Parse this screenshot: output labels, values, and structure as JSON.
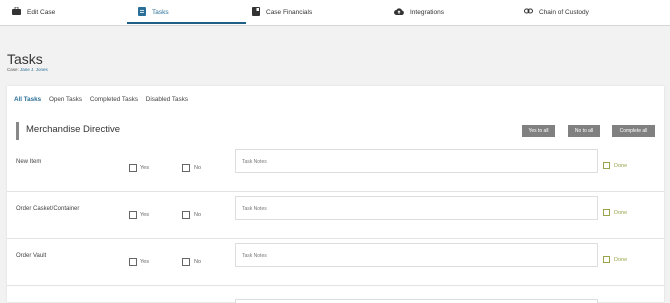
{
  "nav": {
    "tabs": [
      {
        "label": "Edit Case",
        "icon": "briefcase-icon"
      },
      {
        "label": "Tasks",
        "icon": "clipboard-icon"
      },
      {
        "label": "Case Financials",
        "icon": "ledger-icon"
      },
      {
        "label": "Integrations",
        "icon": "cloud-icon"
      },
      {
        "label": "Chain of Custody",
        "icon": "link-icon"
      }
    ],
    "active_tab": "Tasks"
  },
  "page": {
    "title": "Tasks",
    "case_prefix": "Case:",
    "case_name": "Jane J. Jones"
  },
  "subtabs": [
    {
      "label": "All Tasks",
      "active": true
    },
    {
      "label": "Open Tasks",
      "active": false
    },
    {
      "label": "Completed Tasks",
      "active": false
    },
    {
      "label": "Disabled Tasks",
      "active": false
    }
  ],
  "section": {
    "title": "Merchandise Directive",
    "buttons": {
      "yes_all": "Yes to all",
      "no_all": "No to all",
      "complete_all": "Complete all"
    }
  },
  "tasks": [
    {
      "name": "New Item",
      "yes_label": "Yes",
      "no_label": "No",
      "notes_placeholder": "Task Notes",
      "done_label": "Done"
    },
    {
      "name": "Order Casket/Container",
      "yes_label": "Yes",
      "no_label": "No",
      "notes_placeholder": "Task Notes",
      "done_label": "Done"
    },
    {
      "name": "Order Vault",
      "yes_label": "Yes",
      "no_label": "No",
      "notes_placeholder": "Task Notes",
      "done_label": "Done"
    }
  ],
  "colors": {
    "accent": "#2a6f97",
    "button_gray": "#808080",
    "done_olive": "#9aa54b"
  }
}
